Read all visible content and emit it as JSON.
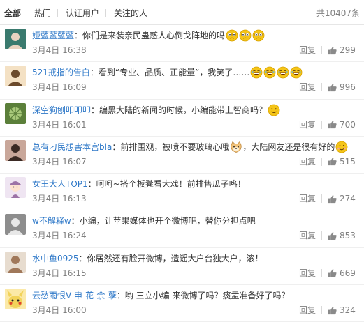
{
  "tabs": [
    {
      "label": "全部"
    },
    {
      "label": "热门"
    },
    {
      "label": "认证用户"
    },
    {
      "label": "关注的人"
    }
  ],
  "total_label": "共10407条",
  "reply_label": "回复",
  "comments": [
    {
      "user": "娅藍藍藍藍",
      "text": "你们是来装亲民蛊惑人心倒戈阵地的吗",
      "emojis": [
        "confused-emoji",
        "confused-emoji",
        "confused-emoji"
      ],
      "time": "3月4日 16:38",
      "likes": "299"
    },
    {
      "user": "521戒指的告白",
      "text": "看到“专业、品质、正能量”，我笑了……",
      "emojis": [
        "laughing-emoji",
        "laughing-emoji",
        "laughing-emoji",
        "laughing-emoji"
      ],
      "time": "3月4日 16:09",
      "likes": "996"
    },
    {
      "user": "深空狗刨叩叩叩",
      "text": "编黑大陆的新闻的时候，小编能带上智商吗？",
      "emojis": [
        "smile-emoji"
      ],
      "time": "3月4日 16:01",
      "likes": "700"
    },
    {
      "user": "总有刁民想害本宫bla",
      "text": "前排围观，被喷不要玻璃心哦",
      "emojis": [
        "doge-emoji"
      ],
      "text2": "，大陆网友还是很有好的",
      "emojis2": [
        "wink-emoji"
      ],
      "time": "3月4日 16:07",
      "likes": "515"
    },
    {
      "user": "女王大人TOP1",
      "text": "呵呵~搭个板凳看大戏！前排售瓜子咯！",
      "emojis": [],
      "time": "3月4日 16:13",
      "likes": "274"
    },
    {
      "user": "w不解释w",
      "text": "小编，让苹果媒体也开个微博吧，替你分担点吧",
      "emojis": [],
      "time": "3月4日 16:24",
      "likes": "853"
    },
    {
      "user": "水中鱼0925",
      "text": "你居然还有脸开微博，造谣大户台独大户，滚！",
      "emojis": [],
      "time": "3月4日 16:15",
      "likes": "669"
    },
    {
      "user": "云愁雨恨V-申-花-余-孽",
      "text": "哟 三立小编 来微博了吗？痰盂准备好了吗？",
      "emojis": [],
      "time": "3月4日 16:00",
      "likes": "324"
    }
  ],
  "avatars": [
    {
      "bg": "#3a7a6e",
      "fg": "#e9d3c0",
      "icon": "avatar-woman"
    },
    {
      "bg": "#f4e1c4",
      "fg": "#6b4a2b",
      "icon": "avatar-anime"
    },
    {
      "bg": "#5b7f3a",
      "fg": "#a8c97a",
      "icon": "avatar-plant"
    },
    {
      "bg": "#c9a79a",
      "fg": "#3b2a24",
      "icon": "avatar-girl"
    },
    {
      "bg": "#efe5f2",
      "fg": "#9c73a6",
      "icon": "avatar-cartoon"
    },
    {
      "bg": "#8d8d8d",
      "fg": "#e8e8e8",
      "icon": "avatar-figure"
    },
    {
      "bg": "#e7dccf",
      "fg": "#a0785a",
      "icon": "avatar-girl2"
    },
    {
      "bg": "#f2d35a",
      "fg": "#7a5a1f",
      "icon": "avatar-pikachu"
    }
  ],
  "colors": {
    "link": "#2e78c8",
    "muted": "#808080",
    "text": "#333333",
    "emoji_face": "#f5c518"
  }
}
